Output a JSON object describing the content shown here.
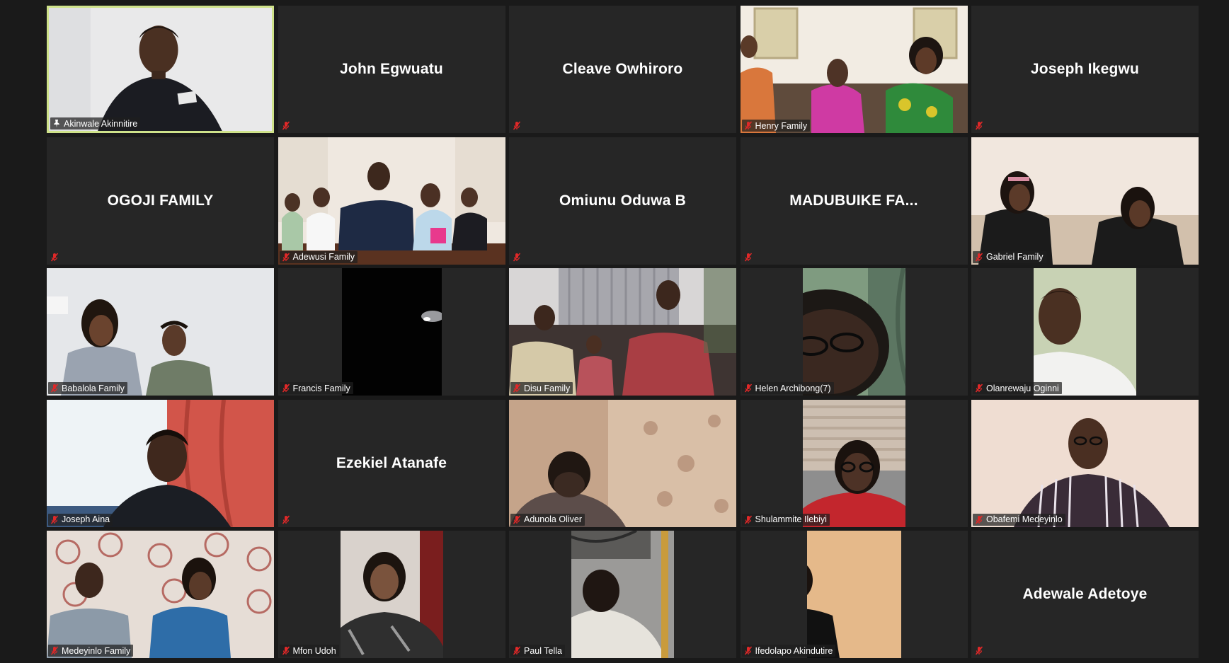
{
  "participants": [
    {
      "name": "Akinwale Akinnitire",
      "display": "video",
      "active": true,
      "mic": "pinned",
      "scene": "man-white-wall",
      "label_shown": true
    },
    {
      "name": "John Egwuatu",
      "display": "name",
      "mic": "muted",
      "label_shown": false
    },
    {
      "name": "Cleave Owhiroro",
      "display": "name",
      "mic": "muted",
      "label_shown": false
    },
    {
      "name": "Henry Family",
      "display": "video",
      "mic": "muted",
      "scene": "family-couch-bright",
      "label_shown": true
    },
    {
      "name": "Joseph Ikegwu",
      "display": "name",
      "mic": "muted",
      "label_shown": false
    },
    {
      "name": "OGOJI FAMILY",
      "display": "name",
      "mic": "muted",
      "label_shown": false
    },
    {
      "name": "Adewusi Family",
      "display": "video",
      "mic": "muted",
      "scene": "family-table",
      "label_shown": true
    },
    {
      "name": "Omiunu Oduwa B",
      "display": "name",
      "mic": "muted",
      "label_shown": false
    },
    {
      "name": "MADUBUIKE  FA...",
      "display": "name",
      "mic": "muted",
      "label_shown": false
    },
    {
      "name": "Gabriel Family",
      "display": "video",
      "mic": "muted",
      "scene": "two-women-couch",
      "label_shown": true
    },
    {
      "name": "Babalola Family",
      "display": "video",
      "mic": "muted",
      "scene": "mother-son-white",
      "label_shown": true
    },
    {
      "name": "Francis Family",
      "display": "video",
      "mic": "muted",
      "scene": "dark-room",
      "label_shown": true
    },
    {
      "name": "Disu Family",
      "display": "video",
      "mic": "muted",
      "scene": "family-sofa-red",
      "label_shown": true
    },
    {
      "name": "Helen Archibong(7)",
      "display": "video",
      "mic": "muted",
      "scene": "closeup-curtain",
      "label_shown": true
    },
    {
      "name": "Olanrewaju Oginni",
      "display": "video",
      "mic": "muted",
      "scene": "man-green-wall",
      "label_shown": true
    },
    {
      "name": "Joseph Aina",
      "display": "video",
      "mic": "muted",
      "scene": "man-red-curtain",
      "label_shown": true
    },
    {
      "name": "Ezekiel Atanafe",
      "display": "name",
      "mic": "muted",
      "label_shown": false
    },
    {
      "name": "Adunola Oliver",
      "display": "video",
      "mic": "muted",
      "scene": "floral-curtain",
      "label_shown": true
    },
    {
      "name": "Shulammite Ilebiyi",
      "display": "video",
      "mic": "muted",
      "scene": "woman-blinds",
      "label_shown": true
    },
    {
      "name": "Obafemi Medeyinlo",
      "display": "video",
      "mic": "muted",
      "scene": "man-striped",
      "label_shown": true
    },
    {
      "name": "Medeyinlo Family",
      "display": "video",
      "mic": "muted",
      "scene": "pattern-wall-two",
      "label_shown": true
    },
    {
      "name": "Mfon Udoh",
      "display": "video",
      "mic": "muted",
      "scene": "woman-curtain-pattern",
      "label_shown": true
    },
    {
      "name": "Paul Tella",
      "display": "video",
      "mic": "muted",
      "scene": "man-looking-up",
      "label_shown": true
    },
    {
      "name": "Ifedolapo Akindutire",
      "display": "video",
      "mic": "muted",
      "scene": "woman-red-chair",
      "label_shown": true
    },
    {
      "name": "Adewale Adetoye",
      "display": "name",
      "mic": "muted",
      "label_shown": false
    }
  ],
  "colors": {
    "background": "#1a1a1a",
    "tile": "#262626",
    "active_border": "#cfe28a",
    "muted_mic": "#e02828",
    "name_text": "#ffffff"
  },
  "icons": {
    "muted": "muted-mic-icon",
    "pinned": "pin-icon"
  }
}
